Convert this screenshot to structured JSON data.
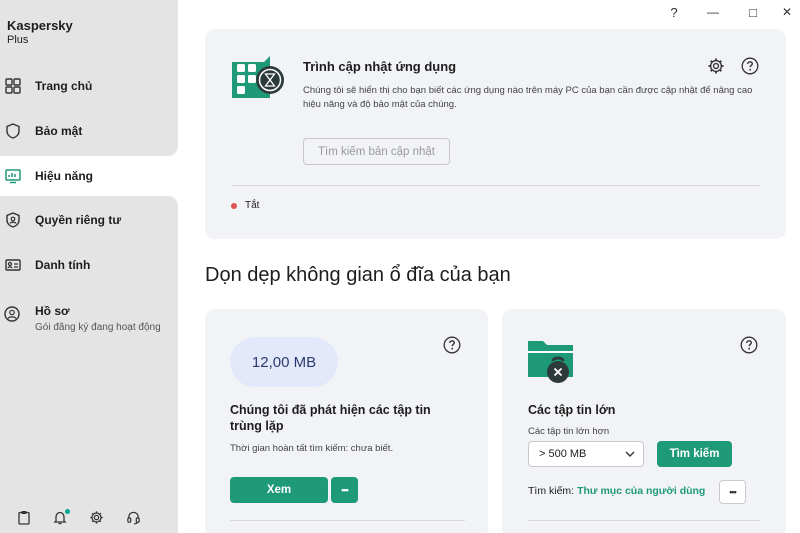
{
  "app": {
    "name": "Kaspersky",
    "edition": "Plus"
  },
  "window_controls": {
    "help": "?",
    "minimize": "—",
    "maximize": "□",
    "close": "✕"
  },
  "sidebar": {
    "items": [
      {
        "label": "Trang chủ",
        "icon": "home-grid-icon"
      },
      {
        "label": "Bảo mật",
        "icon": "shield-icon"
      },
      {
        "label": "Hiệu năng",
        "icon": "monitor-performance-icon",
        "active": true
      },
      {
        "label": "Quyền riêng tư",
        "icon": "privacy-shield-icon"
      },
      {
        "label": "Danh tính",
        "icon": "id-card-icon"
      }
    ],
    "profile": {
      "label": "Hồ sơ",
      "sub": "Gói đăng ký đang hoạt động",
      "icon": "user-icon"
    },
    "footer_icons": [
      "clipboard-icon",
      "bell-icon",
      "gear-icon",
      "headset-icon"
    ]
  },
  "update_card": {
    "title": "Trình cập nhật ứng dụng",
    "description": "Chúng tôi sẽ hiển thị cho bạn biết các ứng dụng nào trên máy PC của bạn cần được cập nhật để nâng cao hiệu năng và độ bảo mật của chúng.",
    "search_button": "Tìm kiếm bản cập nhật",
    "status": "Tắt",
    "status_color": "#e15252"
  },
  "section_title": "Dọn dẹp không gian ổ đĩa của bạn",
  "duplicates_card": {
    "size": "12,00 MB",
    "title": "Chúng tôi đã phát hiện các tập tin trùng lặp",
    "note": "Thời gian hoàn tất tìm kiếm: chưa biết.",
    "view_button": "Xem",
    "more_button": "•••"
  },
  "large_files_card": {
    "title": "Các tập tin lớn",
    "filter_label": "Các tập tin lớn hơn",
    "filter_value": "> 500 MB",
    "find_button": "Tìm kiếm",
    "search_in_label": "Tìm kiếm:",
    "search_in_link": "Thư mục của người dùng",
    "more_button": "•••"
  },
  "colors": {
    "accent": "#1e9a78",
    "sidebar_bg": "#e4e4e4",
    "card_bg": "#f1f3f6"
  }
}
